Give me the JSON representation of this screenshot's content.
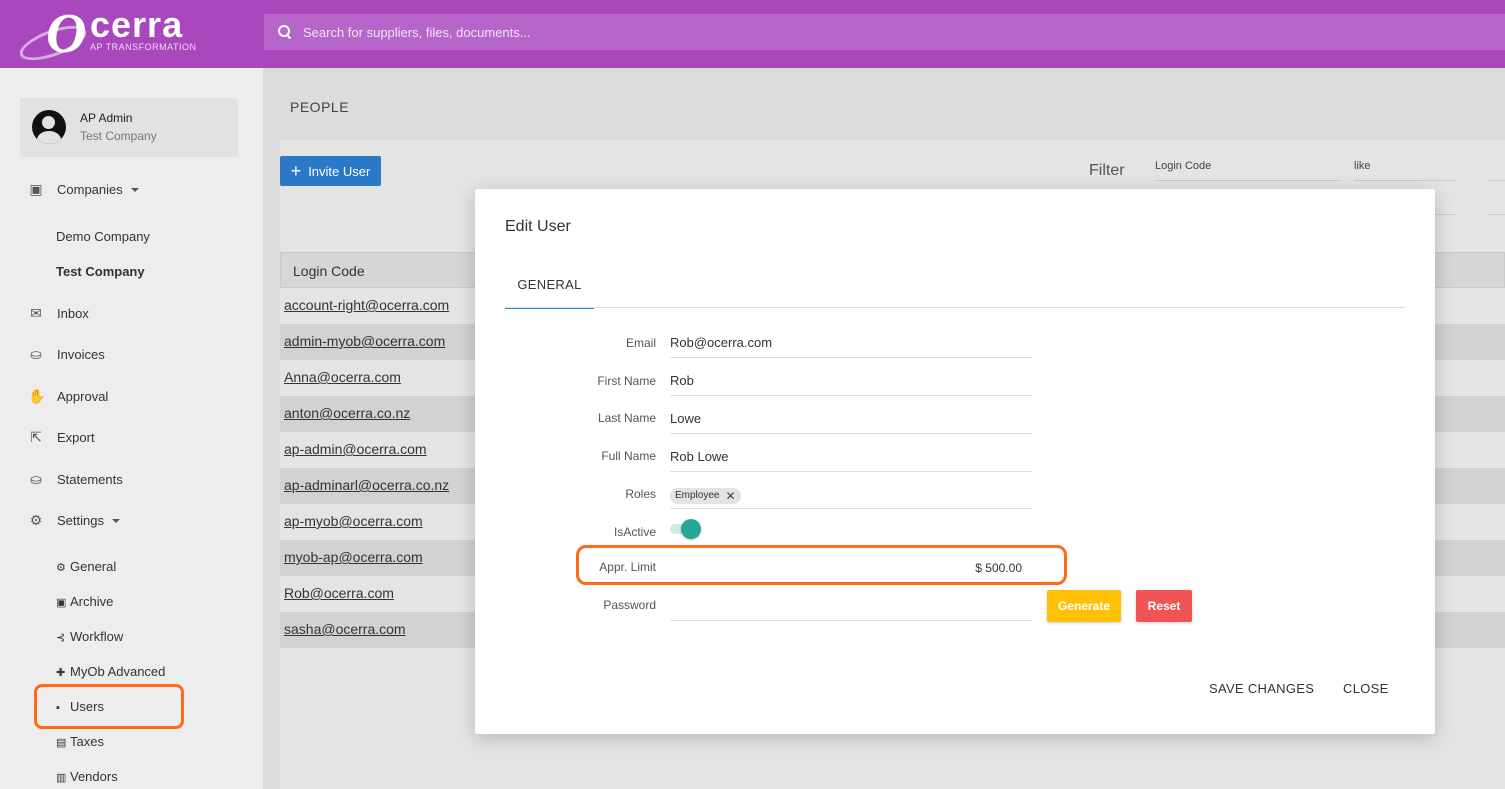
{
  "header": {
    "logo_text": "cerra",
    "logo_letter": "O",
    "logo_tagline": "AP TRANSFORMATION",
    "search_placeholder": "Search for suppliers, files, documents..."
  },
  "user": {
    "name": "AP Admin",
    "company": "Test Company"
  },
  "sidebar": {
    "companies_label": "Companies",
    "companies": [
      "Demo Company",
      "Test Company"
    ],
    "items": [
      {
        "label": "Inbox",
        "icon": "inbox-icon"
      },
      {
        "label": "Invoices",
        "icon": "basket-icon"
      },
      {
        "label": "Approval",
        "icon": "thumbs-icon"
      },
      {
        "label": "Export",
        "icon": "export-icon"
      },
      {
        "label": "Statements",
        "icon": "basket-icon"
      }
    ],
    "settings_label": "Settings",
    "settings_items": [
      "General",
      "Archive",
      "Workflow",
      "MyOb Advanced",
      "Users",
      "Taxes",
      "Vendors"
    ]
  },
  "page": {
    "title": "PEOPLE",
    "invite_label": "Invite User",
    "filter_label": "Filter",
    "filter_field": "Login Code",
    "filter_op": "like",
    "column_login": "Login Code",
    "rows": [
      "account-right@ocerra.com",
      "admin-myob@ocerra.com",
      "Anna@ocerra.com",
      "anton@ocerra.co.nz",
      "ap-admin@ocerra.com",
      "ap-adminarl@ocerra.co.nz",
      "ap-myob@ocerra.com",
      "myob-ap@ocerra.com",
      "Rob@ocerra.com",
      "sasha@ocerra.com"
    ]
  },
  "modal": {
    "title": "Edit User",
    "tab": "GENERAL",
    "labels": {
      "email": "Email",
      "first_name": "First Name",
      "last_name": "Last Name",
      "full_name": "Full Name",
      "roles": "Roles",
      "is_active": "IsActive",
      "appr_limit": "Appr. Limit",
      "password": "Password"
    },
    "values": {
      "email": "Rob@ocerra.com",
      "first_name": "Rob",
      "last_name": "Lowe",
      "full_name": "Rob Lowe",
      "role": "Employee",
      "appr_limit": "$ 500.00",
      "is_active": true
    },
    "generate_label": "Generate",
    "reset_label": "Reset",
    "save_label": "SAVE CHANGES",
    "close_label": "CLOSE"
  },
  "colors": {
    "header": "#a948bd",
    "primary_button": "#2a78c6",
    "highlight": "#ff6a18",
    "toggle": "#26a69a",
    "generate": "#ffc107",
    "reset": "#f05454"
  }
}
